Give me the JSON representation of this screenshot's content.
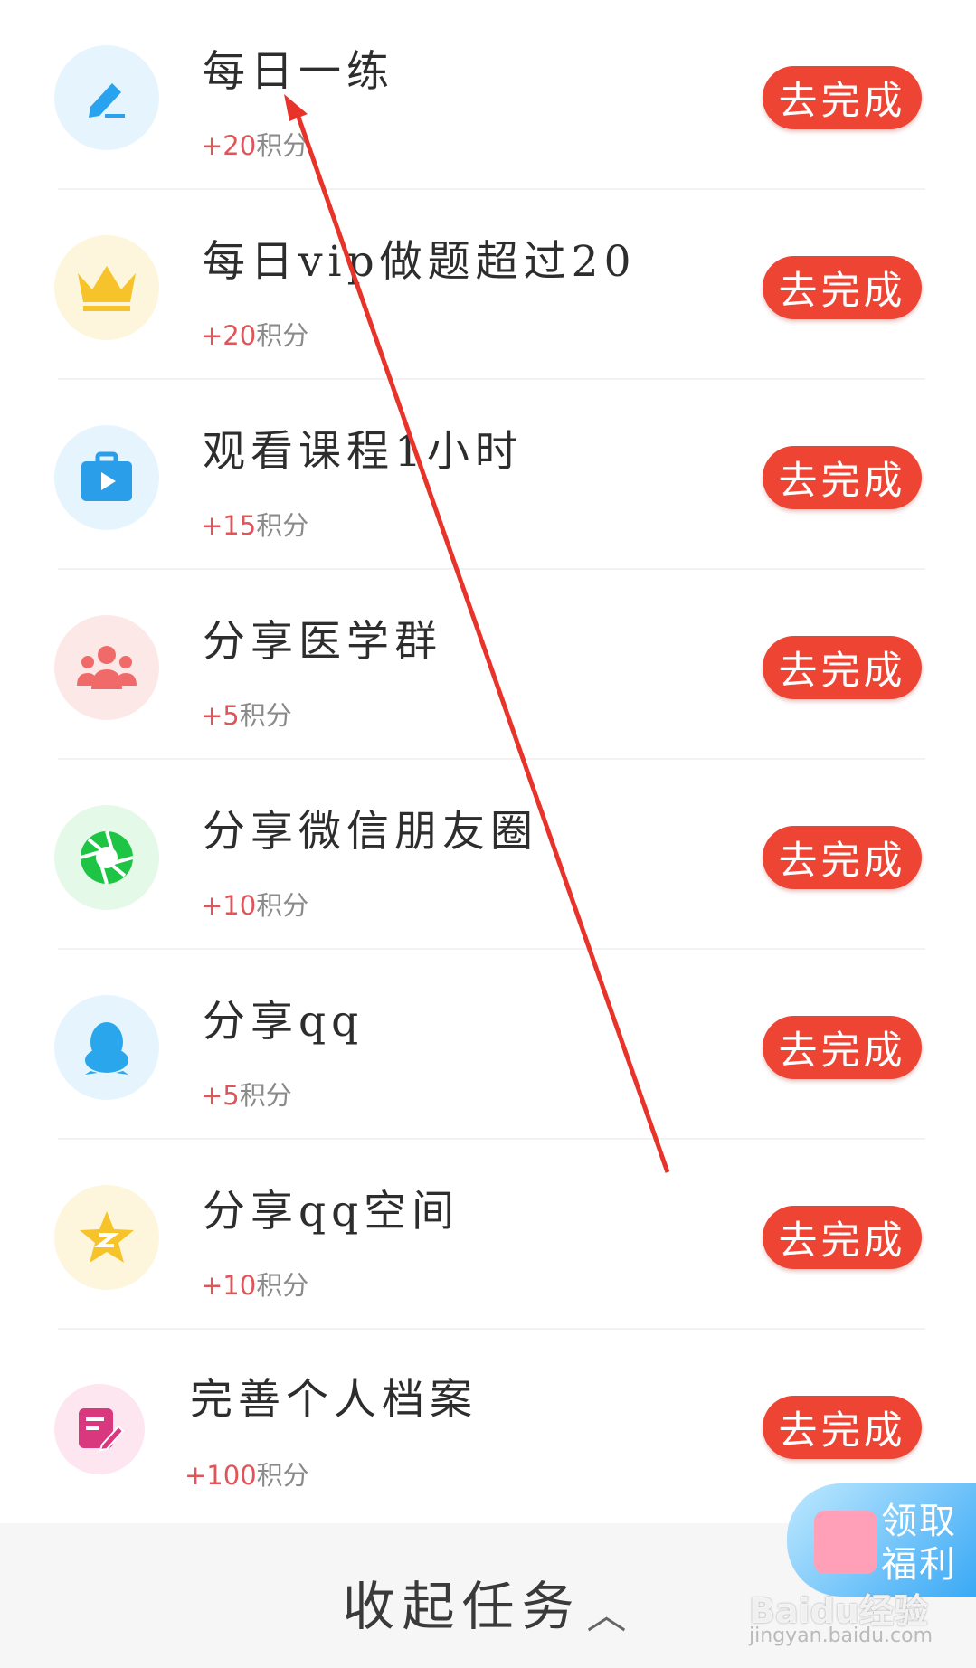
{
  "tasks": [
    {
      "title": "每日一练",
      "points": "+20",
      "unit": "积分",
      "button": "去完成",
      "icon": "pencil-edit-icon",
      "icon_color": "#29a3ee",
      "bg": "#e6f5fd"
    },
    {
      "title": "每日vip做题超过20",
      "points": "+20",
      "unit": "积分",
      "button": "去完成",
      "icon": "crown-icon",
      "icon_color": "#f6c42a",
      "bg": "#fdf6dc"
    },
    {
      "title": "观看课程1小时",
      "points": "+15",
      "unit": "积分",
      "button": "去完成",
      "icon": "video-briefcase-icon",
      "icon_color": "#2b9ee9",
      "bg": "#e6f5fd"
    },
    {
      "title": "分享医学群",
      "points": "+5",
      "unit": "积分",
      "button": "去完成",
      "icon": "group-people-icon",
      "icon_color": "#f06a6a",
      "bg": "#fde8e8"
    },
    {
      "title": "分享微信朋友圈",
      "points": "+10",
      "unit": "积分",
      "button": "去完成",
      "icon": "moments-shutter-icon",
      "icon_color": "#1ec444",
      "bg": "#e4f9e8"
    },
    {
      "title": "分享qq",
      "points": "+5",
      "unit": "积分",
      "button": "去完成",
      "icon": "qq-penguin-icon",
      "icon_color": "#2aa7ec",
      "bg": "#e6f5fd"
    },
    {
      "title": "分享qq空间",
      "points": "+10",
      "unit": "积分",
      "button": "去完成",
      "icon": "qzone-star-icon",
      "icon_color": "#f6c42a",
      "bg": "#fdf6dc"
    },
    {
      "title": "完善个人档案",
      "points": "+100",
      "unit": "积分",
      "button": "去完成",
      "icon": "profile-edit-icon",
      "icon_color": "#d9377e",
      "bg": "#fde6ef"
    }
  ],
  "footer": {
    "collapse_label": "收起任务",
    "chevron_icon": "chevron-up-icon"
  },
  "bonus": {
    "line1": "领取",
    "line2": "福利"
  },
  "watermark": {
    "brand": "Baidu经验",
    "url": "jingyan.baidu.com"
  },
  "annotation": {
    "arrow_color": "#e8332a"
  }
}
